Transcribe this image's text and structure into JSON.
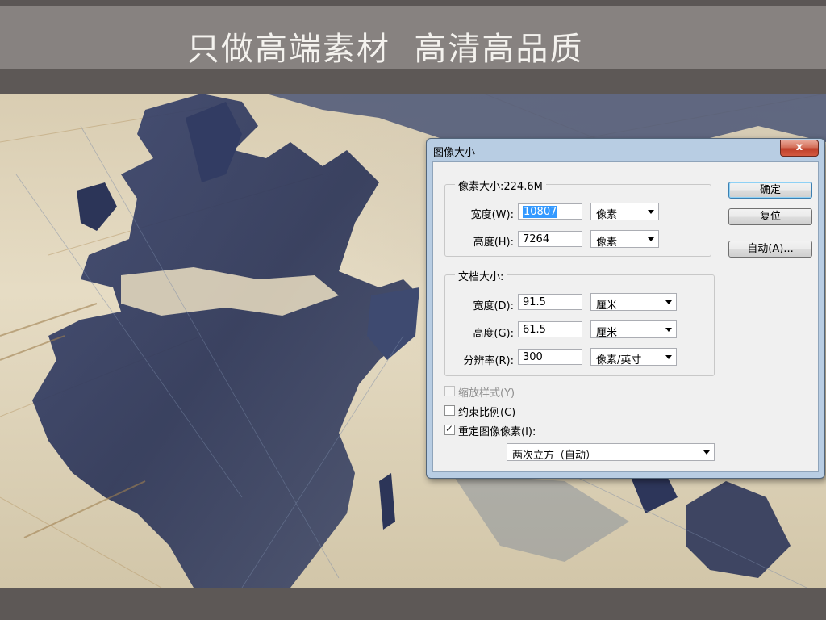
{
  "banner": {
    "text": "只做高端素材  高清高品质"
  },
  "dialog": {
    "title": "图像大小",
    "close": "x",
    "pixel_dimensions": {
      "label": "像素大小:224.6M",
      "width_label": "宽度(W):",
      "width_value": "10807",
      "width_unit": "像素",
      "height_label": "高度(H):",
      "height_value": "7264",
      "height_unit": "像素"
    },
    "document_size": {
      "label": "文档大小:",
      "width_label": "宽度(D):",
      "width_value": "91.5",
      "width_unit": "厘米",
      "height_label": "高度(G):",
      "height_value": "61.5",
      "height_unit": "厘米",
      "resolution_label": "分辨率(R):",
      "resolution_value": "300",
      "resolution_unit": "像素/英寸"
    },
    "options": {
      "scale_styles": {
        "label": "缩放样式(Y)",
        "checked": false,
        "enabled": false
      },
      "constrain": {
        "label": "约束比例(C)",
        "checked": false,
        "enabled": true
      },
      "resample": {
        "label": "重定图像像素(I):",
        "checked": true,
        "enabled": true
      },
      "resample_method": "两次立方（自动）"
    },
    "buttons": {
      "ok": "确定",
      "reset": "复位",
      "auto": "自动(A)..."
    }
  },
  "colors": {
    "map_dark": "#2f3a5c",
    "map_paper": "#dccfb3",
    "banner_bg": "#878280"
  }
}
